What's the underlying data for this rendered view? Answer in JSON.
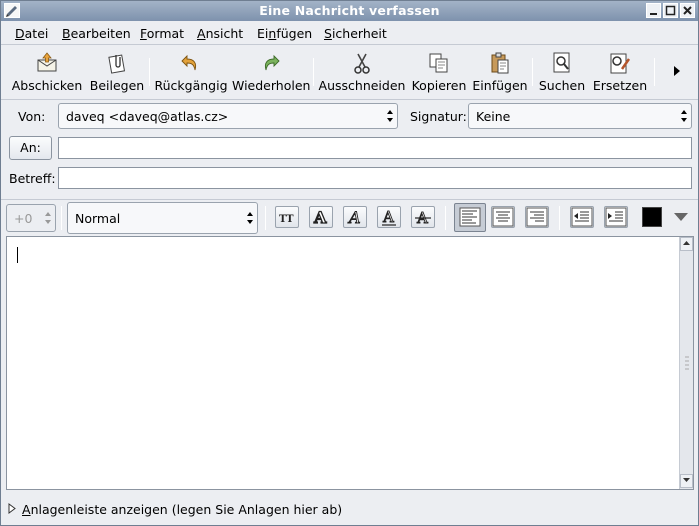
{
  "window": {
    "title": "Eine Nachricht verfassen"
  },
  "menubar": {
    "items": [
      {
        "label": "Datei",
        "mnemonic": "D",
        "rest": "atei"
      },
      {
        "label": "Bearbeiten",
        "mnemonic": "B",
        "rest": "earbeiten"
      },
      {
        "label": "Format",
        "mnemonic": "F",
        "rest": "ormat"
      },
      {
        "label": "Ansicht",
        "mnemonic": "A",
        "rest": "nsicht"
      },
      {
        "label": "Einfügen",
        "pre": "Ei",
        "mnemonic": "n",
        "rest": "fügen"
      },
      {
        "label": "Sicherheit",
        "mnemonic": "S",
        "rest": "icherheit"
      }
    ]
  },
  "toolbar": {
    "send": "Abschicken",
    "attach": "Beilegen",
    "undo": "Rückgängig",
    "redo": "Wiederholen",
    "cut": "Ausschneiden",
    "copy": "Kopieren",
    "paste": "Einfügen",
    "find": "Suchen",
    "replace": "Ersetzen"
  },
  "header": {
    "from_label": "Von:",
    "from_value": "daveq <daveq@atlas.cz>",
    "signature_label": "Signatur:",
    "signature_value": "Keine",
    "to_button": "An:",
    "to_value": "",
    "subject_label": "Betreff:",
    "subject_value": ""
  },
  "format": {
    "font_size": "+0",
    "paragraph_style": "Normal",
    "text_color": "#000000"
  },
  "status": {
    "attachments_pre": "",
    "attachments_mnemonic": "A",
    "attachments_rest": "nlagenleiste anzeigen (legen Sie Anlagen hier ab)"
  }
}
